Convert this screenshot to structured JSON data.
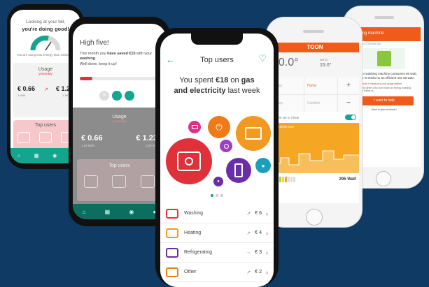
{
  "p1": {
    "line1": "Looking at your bill,",
    "line2": "you're doing good!",
    "small": "You are using less energy than estimated",
    "usage_label": "Usage",
    "usage_sub": "yesterday",
    "val_a": "€ 0.66",
    "val_a_sub": "1 kWh",
    "val_b": "€ 1.23",
    "val_b_sub": "1.90 m³",
    "top_users_label": "Top users"
  },
  "p2": {
    "title": "High five!",
    "msg1": "This month you ",
    "msg_bold": "have saved €15",
    "msg2": " with your ",
    "msg_bold2": "washing",
    "msg3": ".",
    "msg4": "Well done, keep it up!",
    "usage_label": "Usage",
    "usage_sub": "yesterday",
    "val_a": "€ 0.66",
    "val_a_sub": "1.64 kWh",
    "val_b": "€ 1.23",
    "val_b_sub": "1.90 m³",
    "top_users_label": "Top users"
  },
  "p3": {
    "title": "Top users",
    "spent_prefix": "You spent ",
    "spent_amount": "€18",
    "spent_mid": " on ",
    "spent_bold1": "gas",
    "spent_and": "and electricity",
    "spent_tail": " last week",
    "items": [
      {
        "label": "Washing",
        "value": "€ 6",
        "icon": "washing-machine-icon",
        "color": "#e0313a",
        "trend": "↗"
      },
      {
        "label": "Heating",
        "value": "€ 4",
        "icon": "radiator-icon",
        "color": "#f29a1f",
        "trend": "↗"
      },
      {
        "label": "Refrigerating",
        "value": "€ 3",
        "icon": "fridge-icon",
        "color": "#6a2fa8",
        "trend": "→"
      },
      {
        "label": "Other",
        "value": "€ 2",
        "icon": "plug-icon",
        "color": "#f07a16",
        "trend": "↗"
      }
    ]
  },
  "p4": {
    "brand": "TOON",
    "temp": "20.0°",
    "set_label": "set to",
    "set_value": "15.0°",
    "modes": [
      "Away",
      "Home",
      "Sleep",
      "Comfort"
    ],
    "sleep_text": "23:00 set to Sleep",
    "graph_label": "Electricity now",
    "watt": "295 Watt"
  },
  "p5": {
    "header": "Washing machine",
    "sub": "Last updated 2 minutes ago",
    "msg": "Your washing machine consumes 60 watt, that is similar to an efficient one 60 watt.",
    "note": "Tell us because it measures your usage pattern",
    "note2": "Can you help others who don't have an energy washing machine by telling us",
    "cta": "I want to help",
    "link": "Want to give feedback?"
  },
  "colors": {
    "accent_green": "#13a58e",
    "accent_red": "#e0313a",
    "toon_orange": "#f05a1a",
    "background": "#0e3a63"
  }
}
